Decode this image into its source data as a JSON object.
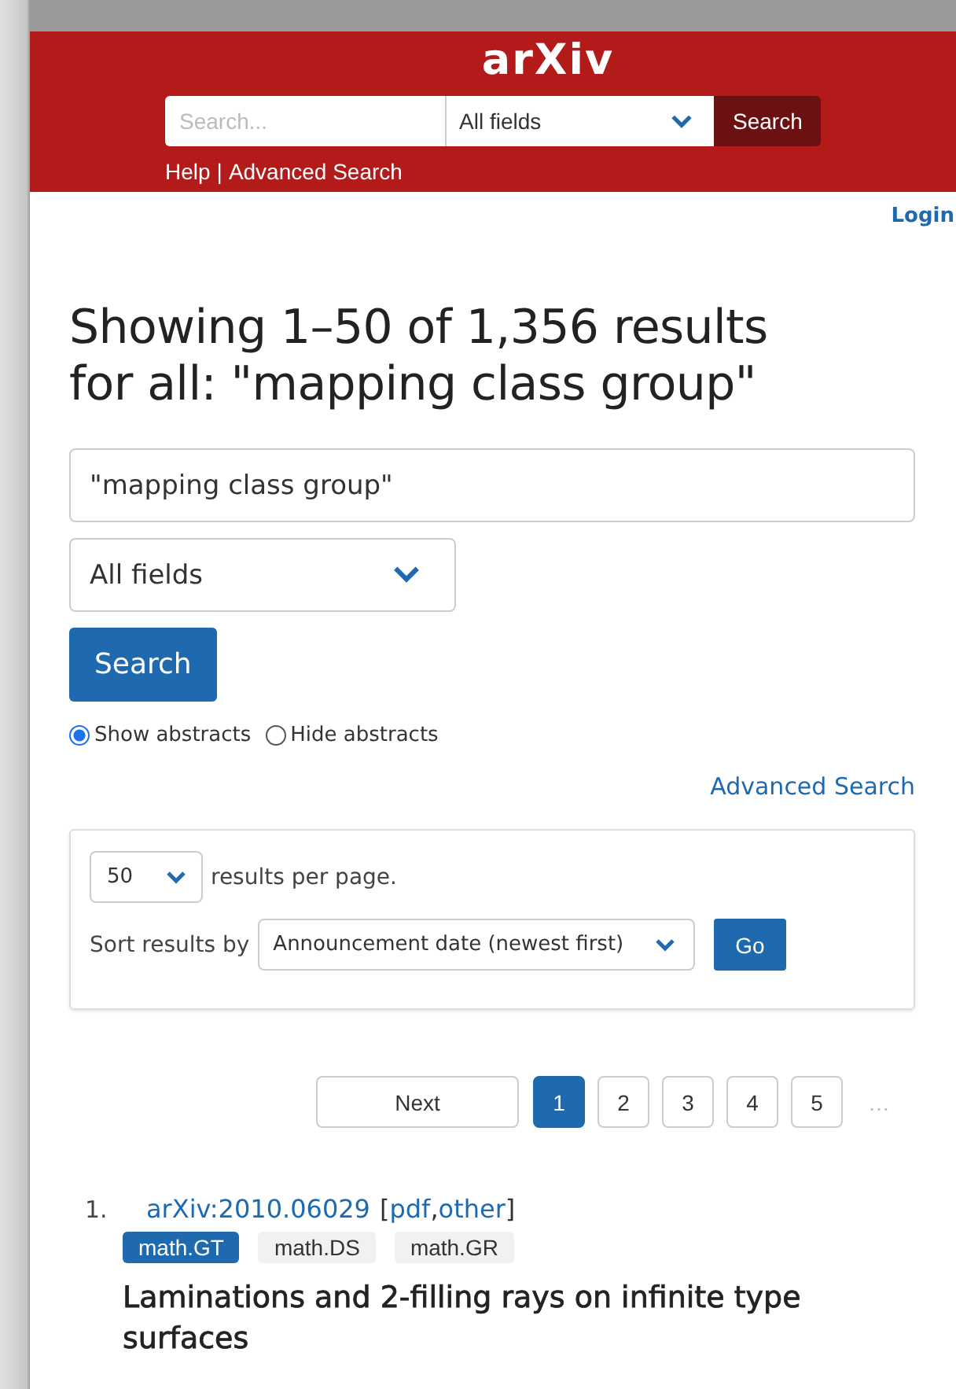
{
  "header": {
    "logo": "arXiv",
    "search": {
      "placeholder": "Search..."
    },
    "field_select": "All fields",
    "search_button": "Search",
    "links": [
      {
        "label": "Help"
      },
      {
        "label": "Advanced Search"
      }
    ],
    "separator": "|"
  },
  "login": "Login",
  "heading": [
    "Showing 1–50 of 1,356 results",
    "for all: \"mapping class group\""
  ],
  "query": {
    "value": "\"mapping class group\""
  },
  "field_select": "All fields",
  "search_button": "Search",
  "abstract_options": [
    {
      "label": "Show abstracts",
      "selected": true
    },
    {
      "label": "Hide abstracts",
      "selected": false
    }
  ],
  "advanced_search": "Advanced Search",
  "options": {
    "per_page": "50",
    "per_page_label": "results per page.",
    "sort_label": "Sort results by",
    "sort": "Announcement date (newest first)",
    "go_button": "Go"
  },
  "pagination": {
    "next": "Next",
    "pages": [
      {
        "label": "1",
        "selected": true
      },
      {
        "label": "2",
        "selected": false
      },
      {
        "label": "3",
        "selected": false
      },
      {
        "label": "4",
        "selected": false
      },
      {
        "label": "5",
        "selected": false
      }
    ],
    "ellipsis": "…"
  },
  "results": [
    {
      "number": "1.",
      "id": "arXiv:2010.06029",
      "formats": [
        "pdf",
        "other"
      ],
      "format_brackets": [
        "[",
        "]"
      ],
      "format_separator": ",",
      "tags": [
        {
          "label": "math.GT",
          "primary": true
        },
        {
          "label": "math.DS",
          "primary": false
        },
        {
          "label": "math.GR",
          "primary": false
        }
      ],
      "title": "Laminations and 2-filling rays on infinite type surfaces"
    }
  ]
}
